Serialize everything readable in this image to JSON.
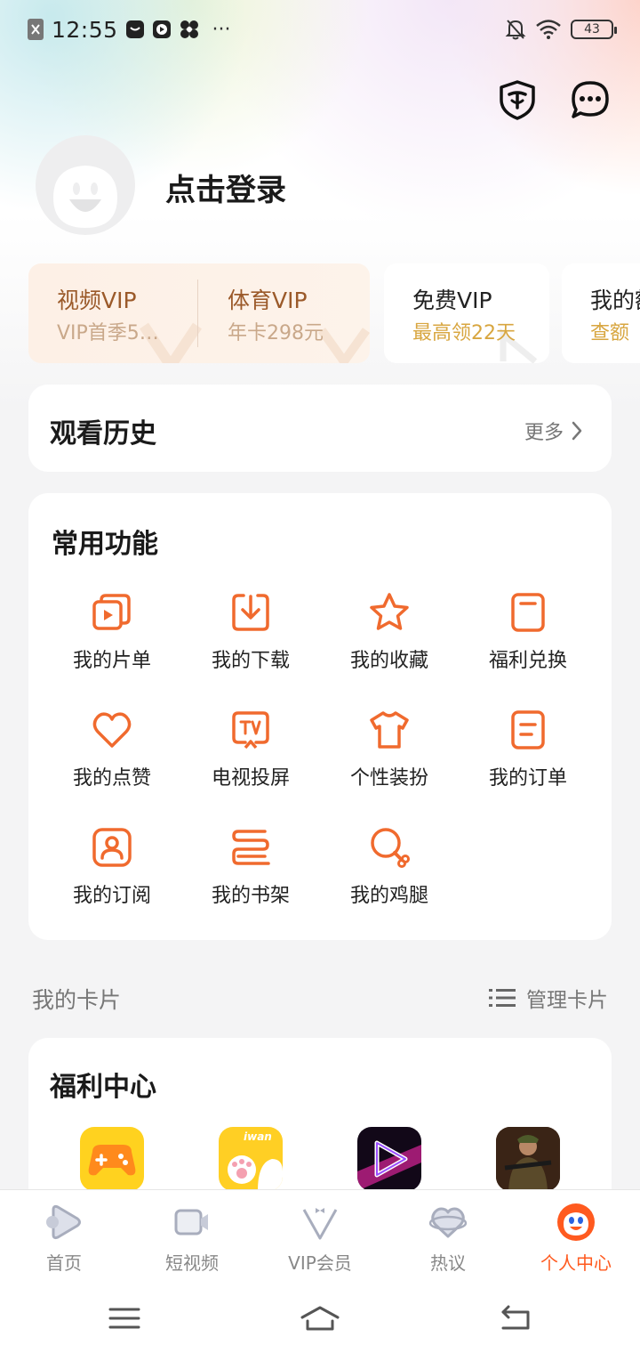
{
  "status_bar": {
    "time": "12:55",
    "battery": "43",
    "dots": "···"
  },
  "profile": {
    "login_text": "点击登录"
  },
  "vip_cards": [
    {
      "title": "视频VIP",
      "subtitle": "VIP首季5…"
    },
    {
      "title": "体育VIP",
      "subtitle": "年卡298元"
    },
    {
      "title": "免费VIP",
      "subtitle": "最高领22天"
    },
    {
      "title": "我的额",
      "subtitle": "查额"
    }
  ],
  "history": {
    "title": "观看历史",
    "more": "更多"
  },
  "functions": {
    "title": "常用功能",
    "items": [
      {
        "label": "我的片单",
        "icon": "playlist-icon"
      },
      {
        "label": "我的下载",
        "icon": "download-icon"
      },
      {
        "label": "我的收藏",
        "icon": "star-icon"
      },
      {
        "label": "福利兑换",
        "icon": "redeem-icon"
      },
      {
        "label": "我的点赞",
        "icon": "heart-icon"
      },
      {
        "label": "电视投屏",
        "icon": "tv-cast-icon"
      },
      {
        "label": "个性装扮",
        "icon": "shirt-icon"
      },
      {
        "label": "我的订单",
        "icon": "order-icon"
      },
      {
        "label": "我的订阅",
        "icon": "subscribe-icon"
      },
      {
        "label": "我的书架",
        "icon": "bookshelf-icon"
      },
      {
        "label": "我的鸡腿",
        "icon": "drumstick-icon"
      }
    ]
  },
  "my_cards": {
    "title": "我的卡片",
    "manage": "管理卡片"
  },
  "welfare": {
    "title": "福利中心",
    "apps": [
      "game-app-icon",
      "iwan-app-icon",
      "video-app-icon",
      "soldier-game-icon"
    ],
    "iwan_text": "iwan"
  },
  "bottom_nav": [
    {
      "label": "首页",
      "icon": "home-play-icon"
    },
    {
      "label": "短视频",
      "icon": "short-video-icon"
    },
    {
      "label": "VIP会员",
      "icon": "vip-icon"
    },
    {
      "label": "热议",
      "icon": "discussion-icon"
    },
    {
      "label": "个人中心",
      "icon": "profile-mascot-icon",
      "active": true
    }
  ],
  "colors": {
    "accent": "#ff5a1f",
    "gold": "#9b5a2a",
    "icon_orange": "#f06a2e"
  }
}
